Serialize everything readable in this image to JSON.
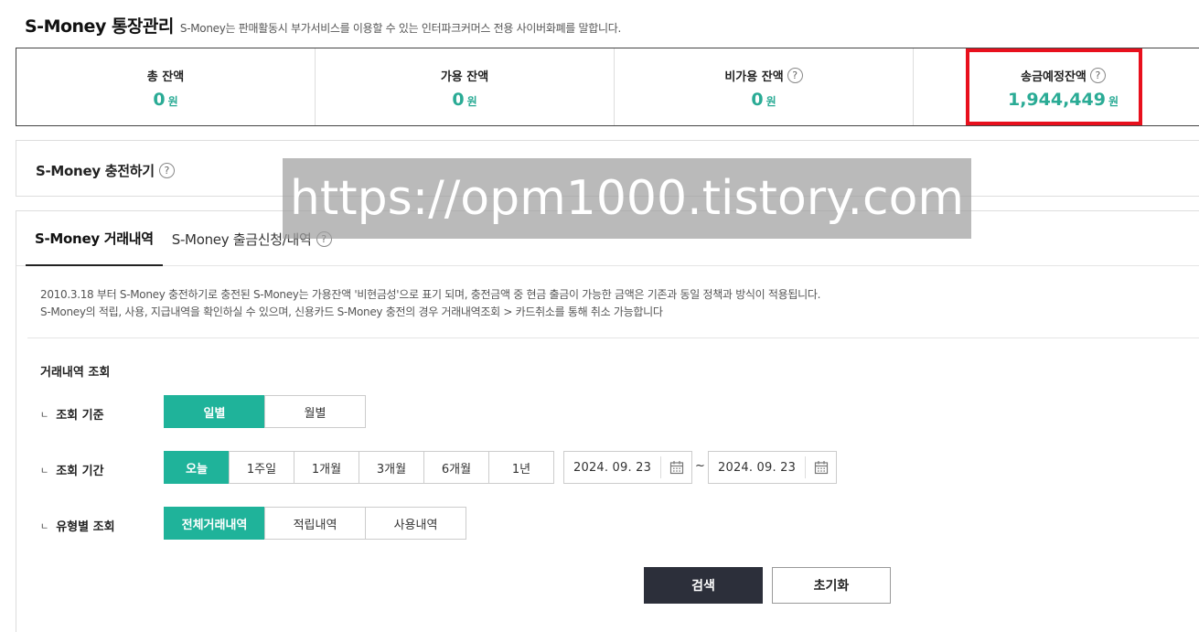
{
  "header": {
    "title": "S-Money 통장관리",
    "description": "S-Money는 판매활동시 부가서비스를 이용할 수 있는 인터파크커머스 전용 사이버화폐를 말합니다."
  },
  "balances": [
    {
      "label": "총 잔액",
      "value": "0",
      "unit": "원",
      "help": false
    },
    {
      "label": "가용 잔액",
      "value": "0",
      "unit": "원",
      "help": false
    },
    {
      "label": "비가용 잔액",
      "value": "0",
      "unit": "원",
      "help": true
    },
    {
      "label": "송금예정잔액",
      "value": "1,944,449",
      "unit": "원",
      "help": true
    }
  ],
  "help_glyph": "?",
  "charge": {
    "title": "S-Money 충전하기"
  },
  "tabs": [
    {
      "label": "S-Money 거래내역",
      "active": true
    },
    {
      "label": "S-Money 출금신청/내역",
      "active": false
    }
  ],
  "notice": {
    "line1": "2010.3.18 부터 S-Money 충전하기로 충전된 S-Money는 가용잔액 '비현금성'으로 표기 되며, 충전금액 중 현금 출금이 가능한 금액은 기존과 동일 정책과 방식이 적용됩니다.",
    "line2": "S-Money의 적립, 사용, 지급내역을 확인하실 수 있으며, 신용카드 S-Money 충전의 경우 거래내역조회 > 카드취소를 통해 취소 가능합니다"
  },
  "search": {
    "section_title": "거래내역 조회",
    "row_mark": "ㄴ",
    "basis_label": "조회 기준",
    "basis_options": [
      "일별",
      "월별"
    ],
    "period_label": "조회 기간",
    "period_options": [
      "오늘",
      "1주일",
      "1개월",
      "3개월",
      "6개월",
      "1년"
    ],
    "start_date": "2024. 09. 23",
    "date_separator": "~",
    "end_date": "2024. 09. 23",
    "type_label": "유형별 조회",
    "type_options": [
      "전체거래내역",
      "적립내역",
      "사용내역"
    ],
    "search_button": "검색",
    "reset_button": "초기화"
  },
  "watermark": "https://opm1000.tistory.com",
  "colors": {
    "accent": "#1fb39a",
    "value": "#2aab95",
    "highlight": "#e8101d",
    "search_button": "#2c2f3a"
  }
}
